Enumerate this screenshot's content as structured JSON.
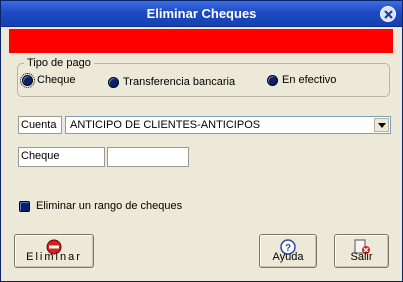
{
  "window": {
    "title": "Eliminar Cheques"
  },
  "payment_group": {
    "legend": "Tipo de pago",
    "options": [
      "Cheque",
      "Transferencia bancaria",
      "En efectivo"
    ]
  },
  "cuenta": {
    "label": "Cuenta",
    "value": "ANTICIPO DE CLIENTES-ANTICIPOS"
  },
  "cheque": {
    "label": "Cheque",
    "value": ""
  },
  "range": {
    "label": "Eliminar un rango de cheques"
  },
  "buttons": {
    "delete": "Eliminar",
    "help": "Ayuda",
    "exit": "Salir"
  },
  "colors": {
    "alert": "#ff0000",
    "title_bar": "#1e4bc4"
  }
}
